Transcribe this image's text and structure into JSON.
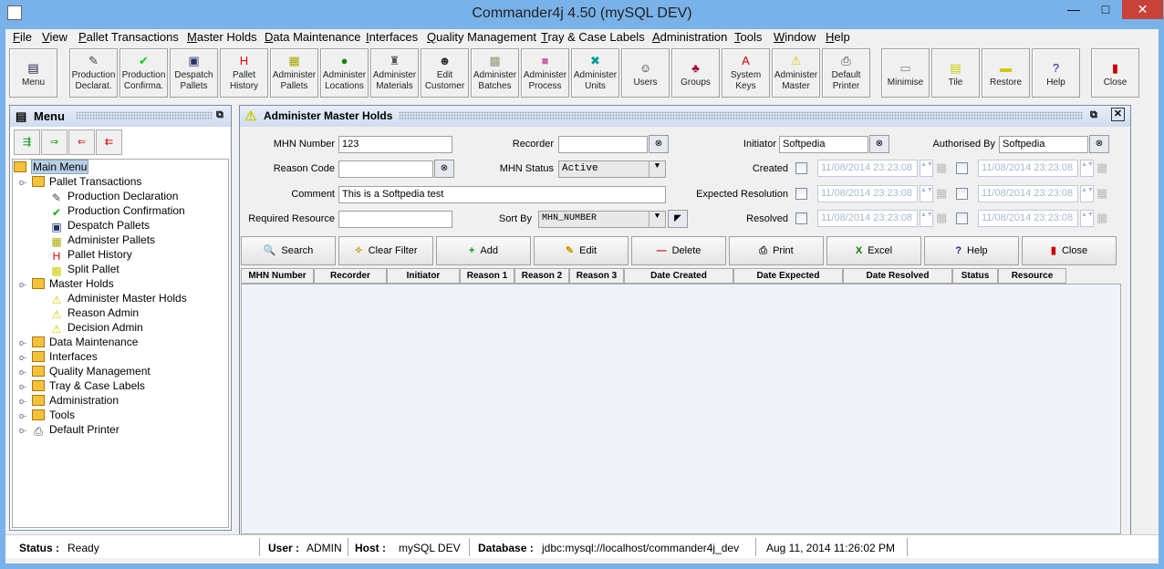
{
  "window": {
    "title": "Commander4j 4.50 (mySQL DEV)",
    "minimize": "—",
    "maximize": "□",
    "close": "✕"
  },
  "menubar": [
    "File",
    "View",
    "Pallet Transactions",
    "Master Holds",
    "Data Maintenance",
    "Interfaces",
    "Quality Management",
    "Tray & Case Labels",
    "Administration",
    "Tools",
    "Window",
    "Help"
  ],
  "toolbar": [
    {
      "l1": "",
      "l2": "Menu",
      "icon": "menu-icon",
      "g": "▤",
      "c": "#224"
    },
    {
      "l1": "Production",
      "l2": "Declarat.",
      "icon": "gun-icon",
      "g": "✎",
      "c": "#444"
    },
    {
      "l1": "Production",
      "l2": "Confirma.",
      "icon": "checkmark-icon",
      "g": "✔",
      "c": "#1c1"
    },
    {
      "l1": "Despatch",
      "l2": "Pallets",
      "icon": "truck-icon",
      "g": "▣",
      "c": "#236"
    },
    {
      "l1": "Pallet",
      "l2": "History",
      "icon": "history-icon",
      "g": "H",
      "c": "#e00"
    },
    {
      "l1": "Administer",
      "l2": "Pallets",
      "icon": "pallet-icon",
      "g": "▦",
      "c": "#aa0"
    },
    {
      "l1": "Administer",
      "l2": "Locations",
      "icon": "globe-icon",
      "g": "●",
      "c": "#180"
    },
    {
      "l1": "Administer",
      "l2": "Materials",
      "icon": "materials-icon",
      "g": "♜",
      "c": "#555"
    },
    {
      "l1": "Edit",
      "l2": "Customer",
      "icon": "customer-icon",
      "g": "☻",
      "c": "#333"
    },
    {
      "l1": "Administer",
      "l2": "Batches",
      "icon": "box-icon",
      "g": "▩",
      "c": "#997"
    },
    {
      "l1": "Administer",
      "l2": "Process",
      "icon": "process-icon",
      "g": "■",
      "c": "#c6a"
    },
    {
      "l1": "Administer",
      "l2": "Units",
      "icon": "units-icon",
      "g": "✖",
      "c": "#099"
    },
    {
      "l1": "",
      "l2": "Users",
      "icon": "user-icon",
      "g": "☺",
      "c": "#222"
    },
    {
      "l1": "",
      "l2": "Groups",
      "icon": "groups-icon",
      "g": "♣",
      "c": "#a03"
    },
    {
      "l1": "System",
      "l2": "Keys",
      "icon": "keys-icon",
      "g": "A",
      "c": "#c00"
    },
    {
      "l1": "Administer",
      "l2": "Master",
      "icon": "warning-icon",
      "g": "⚠",
      "c": "#cc0"
    },
    {
      "l1": "Default",
      "l2": "Printer",
      "icon": "printer-icon",
      "g": "⎙",
      "c": "#444"
    },
    {
      "l1": "",
      "l2": "Minimise",
      "icon": "minimise-icon",
      "g": "▭",
      "c": "#888"
    },
    {
      "l1": "",
      "l2": "Tile",
      "icon": "tile-icon",
      "g": "▤",
      "c": "#cc0"
    },
    {
      "l1": "",
      "l2": "Restore",
      "icon": "restore-icon",
      "g": "▬",
      "c": "#cc0"
    },
    {
      "l1": "",
      "l2": "Help",
      "icon": "help-icon",
      "g": "?",
      "c": "#22a"
    },
    {
      "l1": "",
      "l2": "Close",
      "icon": "close-door-icon",
      "g": "▮",
      "c": "#c00"
    }
  ],
  "menu_panel": {
    "title": "Menu",
    "tree_buttons": [
      "expand-all-icon",
      "expand-icon",
      "collapse-icon",
      "collapse-all-icon"
    ],
    "tree": [
      {
        "label": "Main Menu",
        "level": 0,
        "icon": "folder",
        "selected": true
      },
      {
        "label": "Pallet Transactions",
        "level": 1,
        "icon": "folder"
      },
      {
        "label": "Production Declaration",
        "level": 2,
        "icon": "gun"
      },
      {
        "label": "Production Confirmation",
        "level": 2,
        "icon": "check"
      },
      {
        "label": "Despatch Pallets",
        "level": 2,
        "icon": "truck"
      },
      {
        "label": "Administer Pallets",
        "level": 2,
        "icon": "pallet"
      },
      {
        "label": "Pallet History",
        "level": 2,
        "icon": "history"
      },
      {
        "label": "Split Pallet",
        "level": 2,
        "icon": "split"
      },
      {
        "label": "Master Holds",
        "level": 1,
        "icon": "folder"
      },
      {
        "label": "Administer Master Holds",
        "level": 2,
        "icon": "warning"
      },
      {
        "label": "Reason Admin",
        "level": 2,
        "icon": "warning"
      },
      {
        "label": "Decision Admin",
        "level": 2,
        "icon": "warning"
      },
      {
        "label": "Data Maintenance",
        "level": 1,
        "icon": "folder"
      },
      {
        "label": "Interfaces",
        "level": 1,
        "icon": "folder"
      },
      {
        "label": "Quality Management",
        "level": 1,
        "icon": "folder"
      },
      {
        "label": "Tray & Case Labels",
        "level": 1,
        "icon": "folder"
      },
      {
        "label": "Administration",
        "level": 1,
        "icon": "folder"
      },
      {
        "label": "Tools",
        "level": 1,
        "icon": "folder"
      },
      {
        "label": "Default Printer",
        "level": 1,
        "icon": "printer"
      }
    ]
  },
  "holds": {
    "title": "Administer Master Holds",
    "form": {
      "mhn_number_label": "MHN Number",
      "mhn_number": "123",
      "reason_code_label": "Reason Code",
      "reason_code": "",
      "comment_label": "Comment",
      "comment": "This is a Softpedia test",
      "required_resource_label": "Required Resource",
      "required_resource": "",
      "recorder_label": "Recorder",
      "recorder": "",
      "mhn_status_label": "MHN Status",
      "mhn_status": "Active",
      "sort_by_label": "Sort By",
      "sort_by": "MHN_NUMBER",
      "initiator_label": "Initiator",
      "initiator": "Softpedia",
      "authorised_by_label": "Authorised By",
      "authorised_by": "Softpedia",
      "created_label": "Created",
      "expected_label": "Expected Resolution",
      "resolved_label": "Resolved",
      "date_value": "11/08/2014 23:23:08"
    },
    "buttons": [
      {
        "label": "Search",
        "icon": "search-icon",
        "g": "🔍",
        "c": "#336"
      },
      {
        "label": "Clear Filter",
        "icon": "broom-icon",
        "g": "✧",
        "c": "#c90"
      },
      {
        "label": "Add",
        "icon": "plus-icon",
        "g": "+",
        "c": "#090"
      },
      {
        "label": "Edit",
        "icon": "pencil-icon",
        "g": "✎",
        "c": "#c90"
      },
      {
        "label": "Delete",
        "icon": "minus-icon",
        "g": "—",
        "c": "#d00"
      },
      {
        "label": "Print",
        "icon": "printer-icon",
        "g": "⎙",
        "c": "#444"
      },
      {
        "label": "Excel",
        "icon": "excel-icon",
        "g": "X",
        "c": "#170"
      },
      {
        "label": "Help",
        "icon": "help-icon",
        "g": "?",
        "c": "#22a"
      },
      {
        "label": "Close",
        "icon": "close-door-icon",
        "g": "▮",
        "c": "#c00"
      }
    ],
    "columns": [
      "MHN Number",
      "Recorder",
      "Initiator",
      "Reason 1",
      "Reason 2",
      "Reason 3",
      "Date Created",
      "Date Expected",
      "Date Resolved",
      "Status",
      "Resource"
    ],
    "rows": []
  },
  "status": {
    "status_label": "Status :",
    "status": "Ready",
    "user_label": "User :",
    "user": "ADMIN",
    "host_label": "Host :",
    "host": "mySQL DEV",
    "database_label": "Database :",
    "database": "jdbc:mysql://localhost/commander4j_dev",
    "datetime": "Aug 11, 2014 11:26:02 PM"
  }
}
